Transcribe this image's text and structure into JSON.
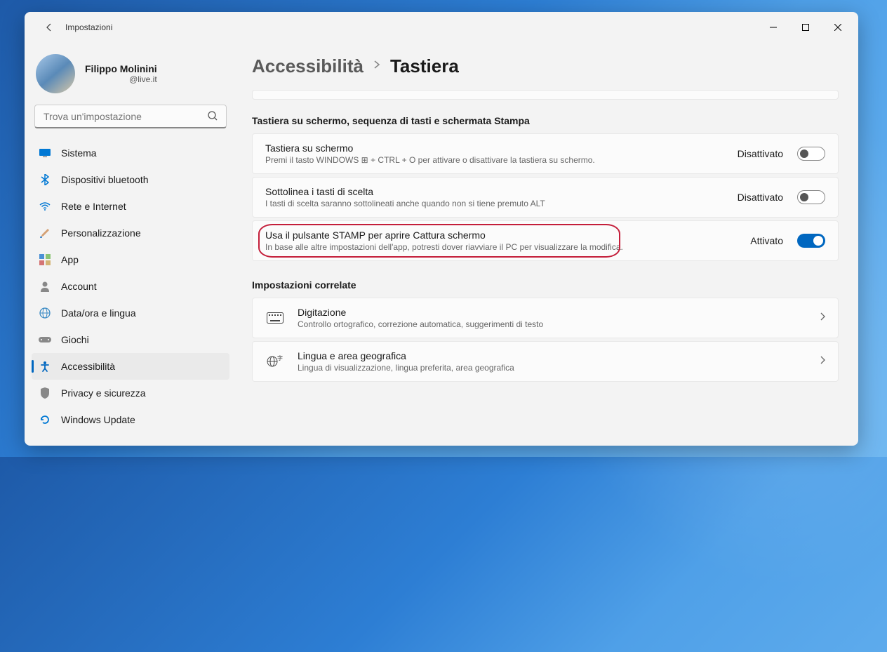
{
  "titlebar": {
    "title": "Impostazioni"
  },
  "profile": {
    "name": "Filippo Molinini",
    "email": "@live.it"
  },
  "search": {
    "placeholder": "Trova un'impostazione"
  },
  "nav": {
    "items": [
      {
        "icon": "💻",
        "label": "Sistema"
      },
      {
        "icon": "bt",
        "label": "Dispositivi bluetooth"
      },
      {
        "icon": "wifi",
        "label": "Rete e Internet"
      },
      {
        "icon": "🖌️",
        "label": "Personalizzazione"
      },
      {
        "icon": "apps",
        "label": "App"
      },
      {
        "icon": "👤",
        "label": "Account"
      },
      {
        "icon": "🌐",
        "label": "Data/ora e lingua"
      },
      {
        "icon": "🎮",
        "label": "Giochi"
      },
      {
        "icon": "acc",
        "label": "Accessibilità"
      },
      {
        "icon": "🛡️",
        "label": "Privacy e sicurezza"
      },
      {
        "icon": "🔄",
        "label": "Windows Update"
      }
    ]
  },
  "breadcrumb": {
    "parent": "Accessibilità",
    "current": "Tastiera"
  },
  "section1_title": "Tastiera su schermo, sequenza di tasti e schermata Stampa",
  "settings": [
    {
      "title": "Tastiera su schermo",
      "desc": "Premi il tasto WINDOWS ⊞ + CTRL + O per attivare o disattivare la tastiera su schermo.",
      "status": "Disattivato",
      "on": false
    },
    {
      "title": "Sottolinea i tasti di scelta",
      "desc": "I tasti di scelta saranno sottolineati anche quando non si tiene premuto ALT",
      "status": "Disattivato",
      "on": false
    },
    {
      "title": "Usa il pulsante STAMP per aprire Cattura schermo",
      "desc": "In base alle altre impostazioni dell'app, potresti dover riavviare il PC per visualizzare la modifica.",
      "status": "Attivato",
      "on": true
    }
  ],
  "section2_title": "Impostazioni correlate",
  "related": [
    {
      "title": "Digitazione",
      "desc": "Controllo ortografico, correzione automatica, suggerimenti di testo"
    },
    {
      "title": "Lingua e area geografica",
      "desc": "Lingua di visualizzazione, lingua preferita, area geografica"
    }
  ]
}
